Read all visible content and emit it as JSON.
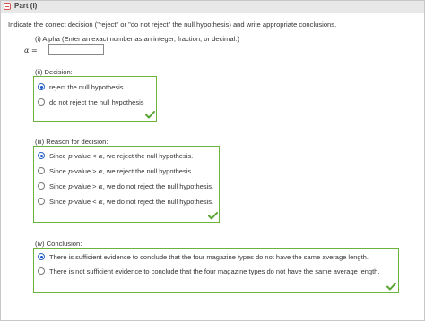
{
  "part": {
    "title": "Part (i)"
  },
  "instructions": "Indicate the correct decision (\"reject\" or \"do not reject\" the null hypothesis) and write appropriate conclusions.",
  "alpha": {
    "label": "(i) Alpha (Enter an exact number as an integer, fraction, or decimal.)",
    "symbol": "α =",
    "value": ""
  },
  "decision": {
    "label": "(ii) Decision:",
    "options": [
      "reject the null hypothesis",
      "do not reject the null hypothesis"
    ],
    "selected_index": 0
  },
  "reason": {
    "label": "(iii) Reason for decision:",
    "options": [
      [
        "Since ",
        "p",
        "-value < ",
        "α",
        ", we reject the null hypothesis."
      ],
      [
        "Since ",
        "p",
        "-value > ",
        "α",
        ", we reject the null hypothesis."
      ],
      [
        "Since ",
        "p",
        "-value > ",
        "α",
        ", we do not reject the null hypothesis."
      ],
      [
        "Since ",
        "p",
        "-value < ",
        "α",
        ", we do not reject the null hypothesis."
      ]
    ],
    "selected_index": 0
  },
  "conclusion": {
    "label": "(iv) Conclusion:",
    "options": [
      "There is sufficient evidence to conclude that the four magazine types do not have the same average length.",
      "There is not sufficient evidence to conclude that the four magazine types do not have the same average length."
    ],
    "selected_index": 0
  },
  "colors": {
    "correct_border": "#6cb33e",
    "check": "#5aa532",
    "radio_selected": "#1a58c5"
  },
  "icons": {
    "collapse": "minus-square-icon",
    "check": "check-mark-icon"
  }
}
